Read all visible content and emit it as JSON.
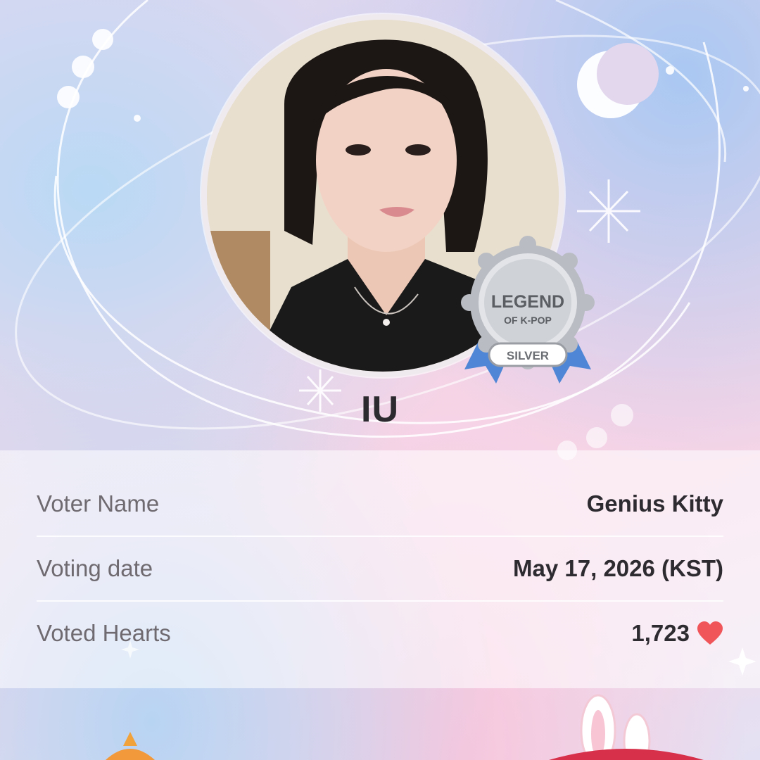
{
  "artist": {
    "name": "IU"
  },
  "badge": {
    "line1": "LEGEND",
    "line2": "OF K-POP",
    "tier": "SILVER"
  },
  "details": {
    "rows": [
      {
        "label": "Voter Name",
        "value": "Genius Kitty"
      },
      {
        "label": "Voting date",
        "value": "May 17, 2026 (KST)"
      },
      {
        "label": "Voted Hearts",
        "value": "1,723",
        "icon": "heart-icon"
      }
    ]
  },
  "colors": {
    "heart": "#f0555a",
    "text_dark": "#2e2b30",
    "text_label": "#6f6a70",
    "badge_silver": "#b9bcc2",
    "ribbon_blue": "#4f86d6"
  }
}
